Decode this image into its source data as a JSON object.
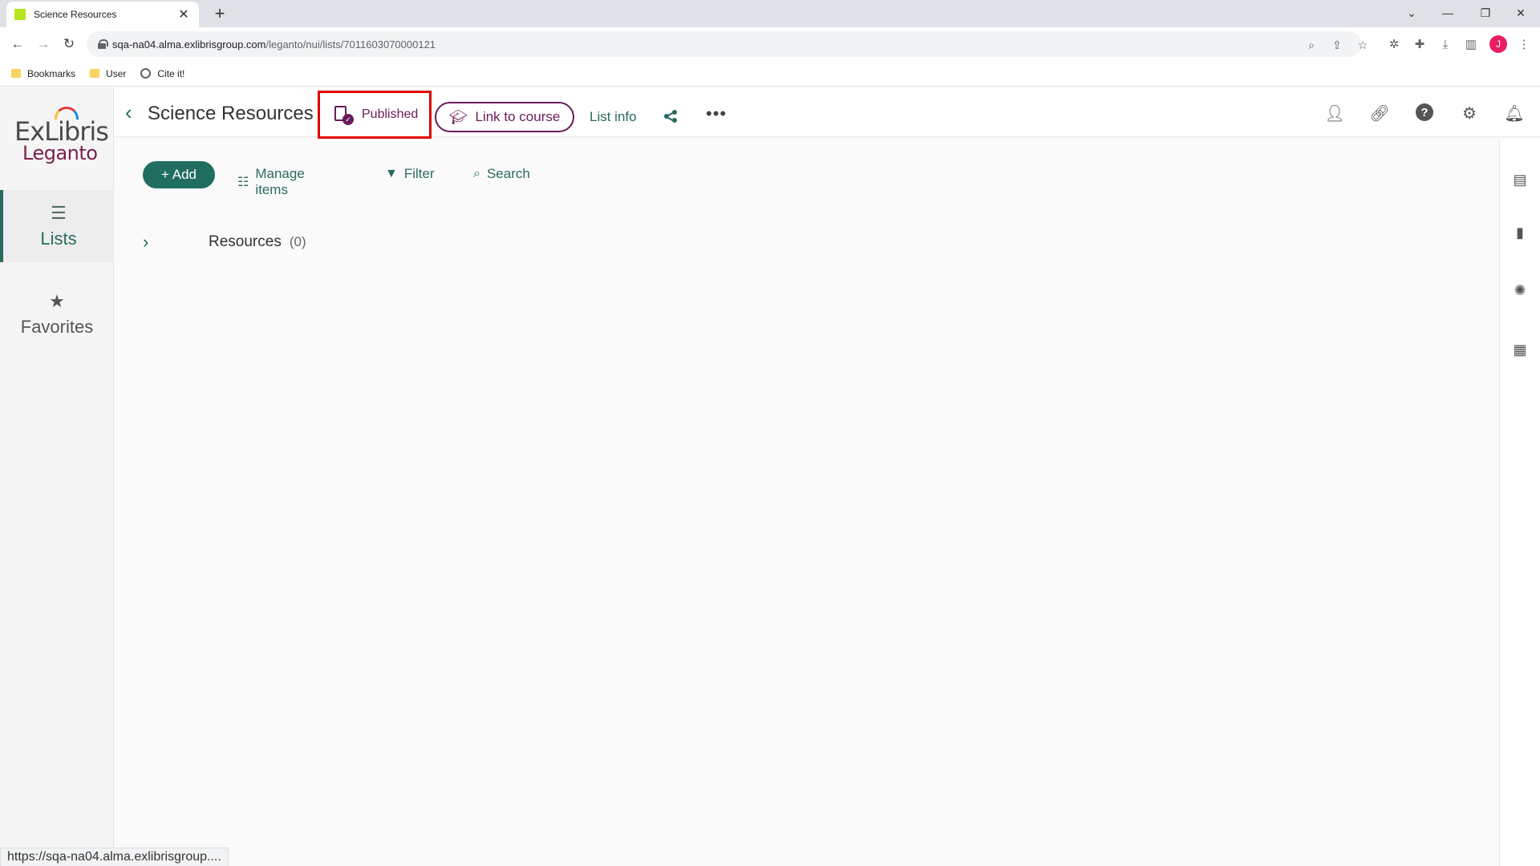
{
  "browser": {
    "tab_title": "Science Resources",
    "new_tab": "+",
    "tab_close": "✕",
    "url_host": "sqa-na04.alma.exlibrisgroup.com",
    "url_path": "/leganto/nui/lists/7011603070000121",
    "profile_initial": "J",
    "bookmarks": [
      {
        "label": "Bookmarks",
        "icon": "folder-icon"
      },
      {
        "label": "User",
        "icon": "folder-icon"
      },
      {
        "label": "Cite it!",
        "icon": "globe-icon"
      }
    ],
    "status_url": "https://sqa-na04.alma.exlibrisgroup...."
  },
  "logo": {
    "line1": "ExLibris",
    "line2": "Leganto"
  },
  "nav": {
    "lists": "Lists",
    "favorites": "Favorites"
  },
  "header": {
    "title": "Science Resources",
    "published": "Published",
    "link_to_course": "Link to course",
    "list_info": "List info",
    "more": "•••"
  },
  "actions": {
    "add": "+ Add",
    "manage_items": "Manage items",
    "filter": "Filter",
    "search": "Search"
  },
  "section": {
    "label": "Resources",
    "count": "(0)"
  },
  "colors": {
    "primary": "#2a6a5e",
    "accent": "#6a1b5a",
    "highlight": "#e00000"
  }
}
